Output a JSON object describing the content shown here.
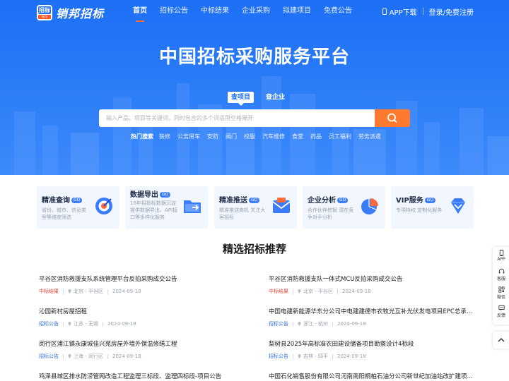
{
  "brand": {
    "logo_top": "招标",
    "logo_bottom": "标讯",
    "name": "销邦招标"
  },
  "nav": {
    "links": [
      "首页",
      "招标公告",
      "中标结果",
      "企业采购",
      "拟建项目",
      "免费公告"
    ],
    "app_download": "APP下载",
    "login": "登录/免费注册"
  },
  "hero": {
    "title": "中国招标采购服务平台",
    "tabs": [
      "查项目",
      "查企业"
    ],
    "search_placeholder": "输入产品、项目等关键词，同时包含的多个词语用空格隔开",
    "hot_label": "热门搜索",
    "hot_items": [
      "装修",
      "公务用车",
      "安防",
      "阀门",
      "校服",
      "汽车维修",
      "食堂",
      "药品",
      "员工福利",
      "劳务派遣"
    ]
  },
  "features": [
    {
      "title": "精准查询",
      "badge": "GO",
      "desc": "省份、城市、信息类型等维度筛选",
      "icon": "target-icon"
    },
    {
      "title": "数据导出",
      "badge": "GO",
      "desc": "16年招投标数据沉淀 提供数据导出、API接口等多样化服务",
      "icon": "folder-export-icon"
    },
    {
      "title": "精准推送",
      "badge": "GO",
      "desc": "精准推送商机 关注大客招标",
      "icon": "mail-icon"
    },
    {
      "title": "企业分析",
      "badge": "GO",
      "desc": "合作伙伴挖掘 潜在竞争对手分析",
      "icon": "pie-chart-icon"
    },
    {
      "title": "VIP服务",
      "badge": "GO",
      "desc": "专项特权 定制化服务",
      "icon": "diamond-icon"
    }
  ],
  "section": {
    "title": "精选招标推荐"
  },
  "recommendations": [
    {
      "title": "平谷区消防救援支队系统管理平台反拍采购成交公告",
      "tag": "中标结果",
      "tag_color": "#e6483d",
      "location": "北京 - 平谷区",
      "date": "2024-09-18"
    },
    {
      "title": "平谷区消防救援支队一体式MCU反拍采购成交公告",
      "tag": "中标结果",
      "tag_color": "#e6483d",
      "location": "北京 - 平谷区",
      "date": "2024-09-18"
    },
    {
      "title": "沁园新村房屋招租",
      "tag": "招标公告",
      "tag_color": "#2f6fe8",
      "location": "江苏 - 无锡",
      "date": "2024-09-18"
    },
    {
      "title": "中国电建新能源华东分公司中电建建德市农牧光互补光伏发电项目EPC总承包...",
      "tag": "招标公告",
      "tag_color": "#2f6fe8",
      "location": "浙江 - 杭州",
      "date": "2024-09-18"
    },
    {
      "title": "闵行区浦江镇永康城佳兴苑房屋外墙外保温修缮工程",
      "tag": "招标公告",
      "tag_color": "#2f6fe8",
      "location": "上海 - 闵行区",
      "date": "2024-09-18"
    },
    {
      "title": "梨树县2025年高标准农田建设储备项目勘察设计4标段",
      "tag": "招标公告",
      "tag_color": "#2f6fe8",
      "location": "吉林 - 四平",
      "date": "2024-09-18"
    },
    {
      "title": "鸡泽县城区排水防涝管网改造工程监理三标段、监理四标段-项目公告",
      "tag": "",
      "tag_color": "#2f6fe8",
      "location": "",
      "date": ""
    },
    {
      "title": "中国石化销售股份有限公司河南南阳桐柏石油分公司新世纪加油站改扩建项目...",
      "tag": "",
      "tag_color": "#2f6fe8",
      "location": "",
      "date": ""
    }
  ],
  "floatbar": [
    "APP",
    "客服",
    "微信",
    "反馈"
  ],
  "colors": {
    "primary": "#1f6ff2",
    "accent": "#ff7a2f",
    "tag_result": "#e6483d",
    "tag_notice": "#2f6fe8"
  }
}
